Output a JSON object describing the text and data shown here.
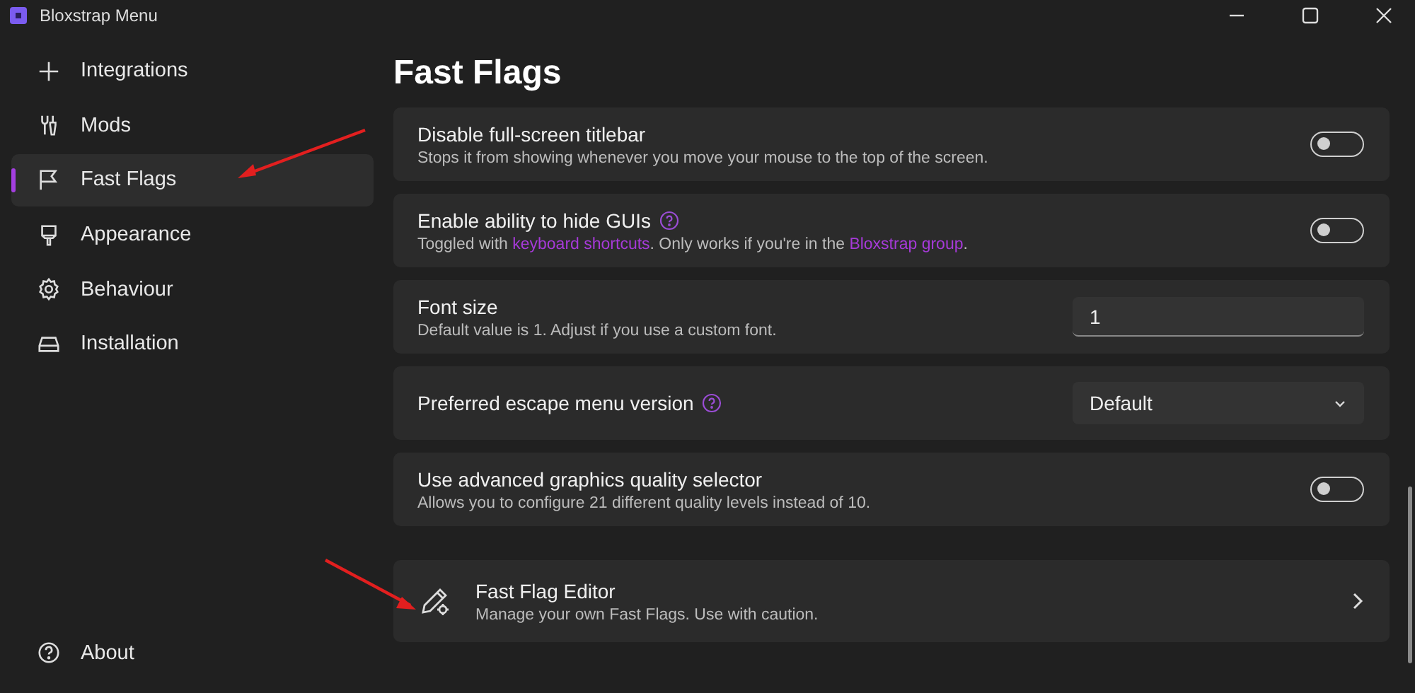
{
  "window": {
    "title": "Bloxstrap Menu"
  },
  "sidebar": {
    "items": [
      {
        "label": "Integrations",
        "selected": false
      },
      {
        "label": "Mods",
        "selected": false
      },
      {
        "label": "Fast Flags",
        "selected": true
      },
      {
        "label": "Appearance",
        "selected": false
      },
      {
        "label": "Behaviour",
        "selected": false
      },
      {
        "label": "Installation",
        "selected": false
      }
    ],
    "footer_items": [
      {
        "label": "About",
        "selected": false
      }
    ]
  },
  "page": {
    "title": "Fast Flags"
  },
  "settings": [
    {
      "kind": "toggle",
      "title": "Disable full-screen titlebar",
      "help": false,
      "description": [
        {
          "text": "Stops it from showing whenever you move your mouse to the top of the screen.",
          "link": false
        }
      ],
      "on": false
    },
    {
      "kind": "toggle",
      "title": "Enable ability to hide GUIs",
      "help": true,
      "description": [
        {
          "text": "Toggled with ",
          "link": false
        },
        {
          "text": "keyboard shortcuts",
          "link": true
        },
        {
          "text": ". Only works if you're in the ",
          "link": false
        },
        {
          "text": "Bloxstrap group",
          "link": true
        },
        {
          "text": ".",
          "link": false
        }
      ],
      "on": false
    },
    {
      "kind": "input",
      "title": "Font size",
      "help": false,
      "description": [
        {
          "text": "Default value is 1. Adjust if you use a custom font.",
          "link": false
        }
      ],
      "value": "1"
    },
    {
      "kind": "dropdown",
      "title": "Preferred escape menu version",
      "help": true,
      "value": "Default"
    },
    {
      "kind": "toggle",
      "title": "Use advanced graphics quality selector",
      "help": false,
      "description": [
        {
          "text": "Allows you to configure 21 different quality levels instead of 10.",
          "link": false
        }
      ],
      "on": false
    },
    {
      "kind": "link",
      "title": "Fast Flag Editor",
      "help": false,
      "description": [
        {
          "text": "Manage your own Fast Flags. Use with caution.",
          "link": false
        }
      ]
    }
  ]
}
